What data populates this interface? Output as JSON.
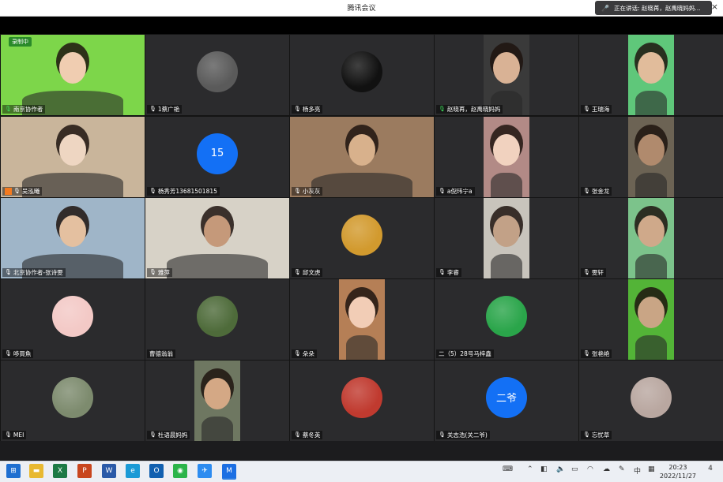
{
  "window": {
    "title": "腾讯会议",
    "close_glyph": "×"
  },
  "speaker": {
    "text": "正在讲话: 赵晓苒，赵禹晓妈妈..."
  },
  "recording": {
    "label": "录制中"
  },
  "tiles": [
    {
      "name": "南京协作者",
      "mic": "on",
      "kind": "video",
      "bg": "#7dd64a",
      "skin": "#f0cdb1"
    },
    {
      "name": "1蔡广艳",
      "mic": "off",
      "kind": "avatar",
      "avatar_bg": "#5a5a5a"
    },
    {
      "name": "杨多亮",
      "mic": "off",
      "kind": "avatar",
      "avatar_bg": "#111111"
    },
    {
      "name": "赵晓苒，赵禹晓妈妈",
      "mic": "on",
      "kind": "video",
      "bg": "#3a3a3a",
      "skin": "#d9b295"
    },
    {
      "name": "王瑞海",
      "mic": "off",
      "kind": "video",
      "bg": "#5fc77a",
      "skin": "#e1bc9b"
    },
    {
      "name": "吴泓曦",
      "mic": "off",
      "kind": "video",
      "bg": "#c9b59b",
      "skin": "#eed6c2",
      "host": true
    },
    {
      "name": "杨秀芳13681501815",
      "mic": "off",
      "kind": "number",
      "avatar_text": "15"
    },
    {
      "name": "小灰灰",
      "mic": "off",
      "kind": "video",
      "bg": "#9b7b5f",
      "skin": "#d8b18c"
    },
    {
      "name": "a倪玮宁a",
      "mic": "off",
      "kind": "video",
      "bg": "#b28a86",
      "skin": "#f1d2bf"
    },
    {
      "name": "张金龙",
      "mic": "off",
      "kind": "video",
      "bg": "#6c6354",
      "skin": "#b08a6d"
    },
    {
      "name": "北京协作者-张诗雯",
      "mic": "off",
      "kind": "video",
      "bg": "#9fb5c8",
      "skin": "#e4c0a0"
    },
    {
      "name": "雅萍",
      "mic": "off",
      "kind": "video",
      "bg": "#d7d2c7",
      "skin": "#c5997a"
    },
    {
      "name": "邱文虎",
      "mic": "off",
      "kind": "avatar",
      "avatar_bg": "#d29a2e"
    },
    {
      "name": "李睿",
      "mic": "off",
      "kind": "video",
      "bg": "#c8c4bc",
      "skin": "#c2a187"
    },
    {
      "name": "雯轩",
      "mic": "off",
      "kind": "video",
      "bg": "#7cc38b",
      "skin": "#cfa98a"
    },
    {
      "name": "哆買魚",
      "mic": "off",
      "kind": "avatar",
      "avatar_bg": "#f3c9c6"
    },
    {
      "name": "曹德翁翁",
      "mic": "none",
      "kind": "avatar",
      "avatar_bg": "#4e6b3a"
    },
    {
      "name": "朵朵",
      "mic": "off",
      "kind": "video",
      "bg": "#b57f56",
      "skin": "#f2cdb6"
    },
    {
      "name": "二（5）28号马梓鑫",
      "mic": "none",
      "kind": "avatar",
      "avatar_bg": "#2aa54a"
    },
    {
      "name": "张艳艳",
      "mic": "off",
      "kind": "video",
      "bg": "#53b437",
      "skin": "#c9a585"
    },
    {
      "name": "MEI",
      "mic": "off",
      "kind": "avatar",
      "avatar_bg": "#7d8b6e"
    },
    {
      "name": "杜语晨妈妈",
      "mic": "off",
      "kind": "video",
      "bg": "#6e7761",
      "skin": "#d4a885"
    },
    {
      "name": "蔡冬英",
      "mic": "off",
      "kind": "avatar",
      "avatar_bg": "#c03a2f"
    },
    {
      "name": "关志浩(关二爷)",
      "mic": "off",
      "kind": "number",
      "avatar_text": "二爷"
    },
    {
      "name": "忘忧草",
      "mic": "off",
      "kind": "avatar",
      "avatar_bg": "#b9a7a0"
    }
  ],
  "taskbar": {
    "apps": [
      {
        "icon": "windows-start-icon",
        "color": "#1f6fd0"
      },
      {
        "icon": "file-explorer-icon",
        "color": "#e8b931"
      },
      {
        "icon": "excel-icon",
        "color": "#1d7a45"
      },
      {
        "icon": "powerpoint-icon",
        "color": "#c8461e"
      },
      {
        "icon": "word-icon",
        "color": "#2a5aa8"
      },
      {
        "icon": "edge-icon",
        "color": "#1a9ad6"
      },
      {
        "icon": "outlook-icon",
        "color": "#1160b0"
      },
      {
        "icon": "wechat-icon",
        "color": "#2bb44a"
      },
      {
        "icon": "feishu-icon",
        "color": "#2d8cf0"
      },
      {
        "icon": "tencent-meeting-icon",
        "color": "#1c6fe3"
      }
    ],
    "ime": "中",
    "time": "20:23",
    "date": "2022/11/27",
    "notification_count": "4"
  }
}
